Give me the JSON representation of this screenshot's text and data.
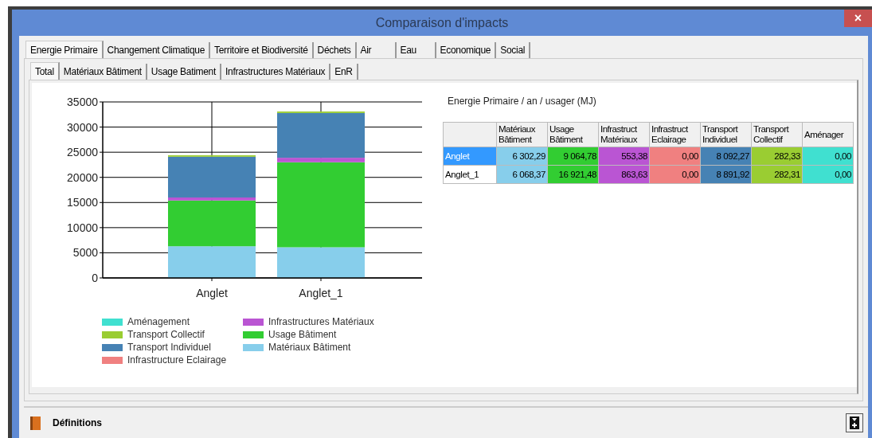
{
  "window": {
    "title": "Comparaison d'impacts",
    "close": "×"
  },
  "tabs": [
    {
      "label": "Energie Primaire",
      "selected": true
    },
    {
      "label": "Changement Climatique",
      "selected": false
    },
    {
      "label": "Territoire et Biodiversité",
      "selected": false
    },
    {
      "label": "Déchets",
      "selected": false
    },
    {
      "label": "Air",
      "selected": false
    },
    {
      "label": "Eau",
      "selected": false
    },
    {
      "label": "Economique",
      "selected": false
    },
    {
      "label": "Social",
      "selected": false
    }
  ],
  "subtabs": [
    {
      "label": "Total",
      "selected": true
    },
    {
      "label": "Matériaux Bâtiment",
      "selected": false
    },
    {
      "label": "Usage Batiment",
      "selected": false
    },
    {
      "label": "Infrastructures Matériaux",
      "selected": false
    },
    {
      "label": "EnR",
      "selected": false
    }
  ],
  "chart": {
    "chart_data": {
      "type": "bar",
      "stacked": true,
      "grid": true,
      "categories": [
        "Anglet",
        "Anglet_1"
      ],
      "ylim": [
        0,
        35000
      ],
      "yticks": [
        0,
        5000,
        10000,
        15000,
        20000,
        25000,
        30000,
        35000
      ],
      "series": [
        {
          "name": "Aménagement",
          "color": "#40e0d0",
          "values": [
            0,
            0
          ]
        },
        {
          "name": "Transport Collectif",
          "color": "#9acd32",
          "values": [
            300,
            300
          ]
        },
        {
          "name": "Transport Individuel",
          "color": "#4682b4",
          "values": [
            8100,
            8900
          ]
        },
        {
          "name": "Infrastructure Eclairage",
          "color": "#f08080",
          "values": [
            0,
            0
          ]
        },
        {
          "name": "Infrastructures Matériaux",
          "color": "#ba55d3",
          "values": [
            600,
            900
          ]
        },
        {
          "name": "Usage Bâtiment",
          "color": "#32cd32",
          "values": [
            9100,
            16900
          ]
        },
        {
          "name": "Matériaux Bâtiment",
          "color": "#87ceeb",
          "values": [
            6300,
            6100
          ]
        }
      ]
    }
  },
  "table": {
    "title": "Energie Primaire / an / usager (MJ)",
    "columns": [
      {
        "label": "Matériaux Bâtiment",
        "color": "#87ceeb"
      },
      {
        "label": "Usage Bâtiment",
        "color": "#32cd32"
      },
      {
        "label": "Infrastruct Matériaux",
        "color": "#ba55d3"
      },
      {
        "label": "Infrastruct Eclairage",
        "color": "#f08080"
      },
      {
        "label": "Transport Individuel",
        "color": "#4682b4"
      },
      {
        "label": "Transport Collectif",
        "color": "#9acd32"
      },
      {
        "label": "Aménager",
        "color": "#40e0d0"
      }
    ],
    "rows": [
      {
        "name": "Anglet",
        "selected": true,
        "cells": [
          "6 302,29",
          "9 064,78",
          "553,38",
          "0,00",
          "8 092,27",
          "282,33",
          "0,00"
        ]
      },
      {
        "name": "Anglet_1",
        "selected": false,
        "cells": [
          "6 068,37",
          "16 921,48",
          "863,63",
          "0,00",
          "8 891,92",
          "282,31",
          "0,00"
        ]
      }
    ]
  },
  "footer": {
    "label": "Définitions"
  }
}
